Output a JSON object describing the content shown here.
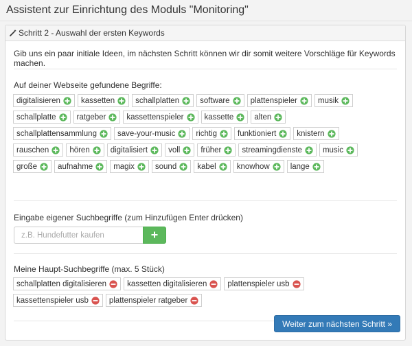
{
  "page": {
    "title": "Assistent zur Einrichtung des Moduls \"Monitoring\""
  },
  "panel": {
    "heading": "Schritt 2 - Auswahl der ersten Keywords",
    "intro": "Gib uns ein paar initiale Ideen, im nächsten Schritt können wir dir somit weitere Vorschläge für Keywords machen."
  },
  "found_terms": {
    "label": "Auf deiner Webseite gefundene Begriffe:",
    "items": [
      "digitalisieren",
      "kassetten",
      "schallplatten",
      "software",
      "plattenspieler",
      "musik",
      "schallplatte",
      "ratgeber",
      "kassettenspieler",
      "kassette",
      "alten",
      "schallplattensammlung",
      "save-your-music",
      "richtig",
      "funktioniert",
      "knistern",
      "rauschen",
      "hören",
      "digitalisiert",
      "voll",
      "früher",
      "streamingdienste",
      "music",
      "große",
      "aufnahme",
      "magix",
      "sound",
      "kabel",
      "knowhow",
      "lange"
    ]
  },
  "custom_input": {
    "label": "Eingabe eigener Suchbegriffe (zum Hinzufügen Enter drücken)",
    "placeholder": "z.B. Hundefutter kaufen",
    "value": ""
  },
  "main_terms": {
    "label": "Meine Haupt-Suchbegriffe (max. 5 Stück)",
    "items": [
      "schallplatten digitalisieren",
      "kassetten digitalisieren",
      "plattenspieler usb",
      "kassettenspieler usb",
      "plattenspieler ratgeber"
    ]
  },
  "footer": {
    "next_label": "Weiter zum nächsten Schritt »"
  },
  "colors": {
    "add": "#5cb85c",
    "remove": "#d9534f",
    "primary": "#337ab7"
  },
  "icons": {
    "heading": "magic-wand-icon",
    "add": "plus-circle-icon",
    "remove": "minus-circle-icon",
    "input_add": "plus-icon"
  }
}
